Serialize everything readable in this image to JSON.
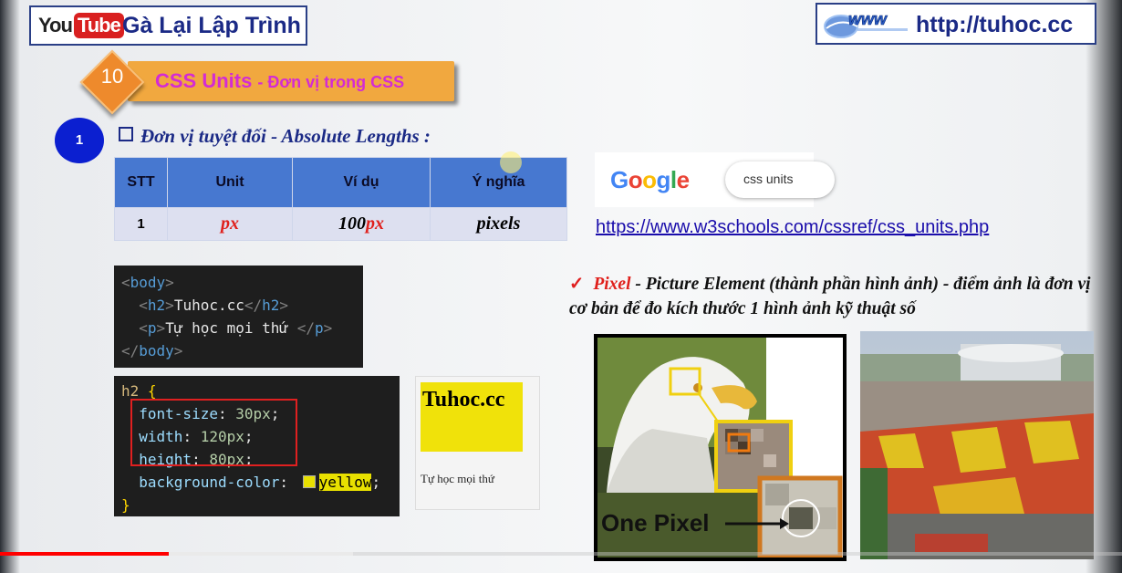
{
  "header": {
    "yt_you": "You",
    "yt_tube": "Tube",
    "channel_name": "Gà Lại Lập Trình",
    "www_text": "www",
    "site_url": "http://tuhoc.cc"
  },
  "lesson": {
    "number": "10",
    "title_main": "CSS Units",
    "title_sub": "- Đơn vị trong CSS"
  },
  "section": {
    "number": "1",
    "heading": "Đơn vị tuyệt đối - Absolute Lengths :"
  },
  "table": {
    "headers": [
      "STT",
      "Unit",
      "Ví dụ",
      "Ý nghĩa"
    ],
    "rows": [
      {
        "stt": "1",
        "unit": "px",
        "example_num": "100",
        "example_unit": "px",
        "meaning": "pixels"
      }
    ]
  },
  "html_code": {
    "line1_tag": "body",
    "line2_tag": "h2",
    "line2_text": "Tuhoc.cc",
    "line3_tag": "p",
    "line3_text": "Tự học mọi thứ "
  },
  "css_code": {
    "selector": "h2",
    "open": "{",
    "close": "}",
    "decls": [
      {
        "prop": "font-size",
        "value": "30px"
      },
      {
        "prop": "width",
        "value": "120px"
      },
      {
        "prop": "height",
        "value": "80px"
      }
    ],
    "bg_prop": "background-color",
    "bg_value": "yellow"
  },
  "preview": {
    "h2": "Tuhoc.cc",
    "p": "Tự học mọi thứ"
  },
  "google": {
    "logo_letters": [
      "G",
      "o",
      "o",
      "g",
      "l",
      "e"
    ],
    "logo_colors": [
      "#4285f4",
      "#ea4335",
      "#fbbc05",
      "#4285f4",
      "#34a853",
      "#ea4335"
    ],
    "search_query": "css units"
  },
  "link": "https://www.w3schools.com/cssref/css_units.php",
  "pixel_description": {
    "term": "Pixel",
    "definition": " - Picture Element (thành phần hình ảnh) - điểm ảnh là đơn vị cơ bản để đo kích thước 1 hình ảnh kỹ thuật số"
  },
  "eagle_caption": "One Pixel",
  "player": {
    "played_fraction": 0.15,
    "buffered_fraction": 0.315
  }
}
